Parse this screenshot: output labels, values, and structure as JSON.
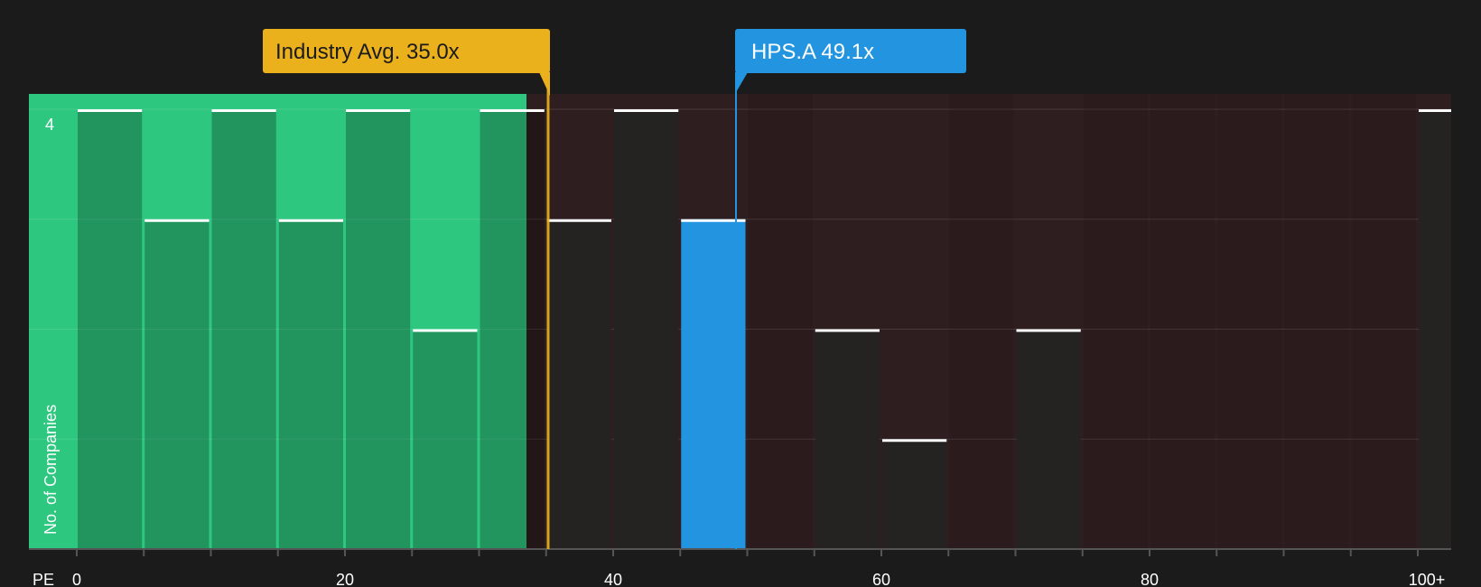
{
  "chart_data": {
    "type": "bar",
    "xlabel": "PE",
    "ylabel": "No. of Companies",
    "x_ticks": [
      "0",
      "20",
      "40",
      "60",
      "80",
      "100+"
    ],
    "y_tick_labels": [
      "4"
    ],
    "bins": [
      {
        "from": 0,
        "to": 5,
        "count": 4
      },
      {
        "from": 5,
        "to": 10,
        "count": 3
      },
      {
        "from": 10,
        "to": 15,
        "count": 4
      },
      {
        "from": 15,
        "to": 20,
        "count": 3
      },
      {
        "from": 20,
        "to": 25,
        "count": 4
      },
      {
        "from": 25,
        "to": 30,
        "count": 2
      },
      {
        "from": 30,
        "to": 35,
        "count": 4
      },
      {
        "from": 35,
        "to": 40,
        "count": 3
      },
      {
        "from": 40,
        "to": 45,
        "count": 4
      },
      {
        "from": 45,
        "to": 50,
        "count": 3
      },
      {
        "from": 50,
        "to": 55,
        "count": 0
      },
      {
        "from": 55,
        "to": 60,
        "count": 2
      },
      {
        "from": 60,
        "to": 65,
        "count": 1
      },
      {
        "from": 65,
        "to": 70,
        "count": 0
      },
      {
        "from": 70,
        "to": 75,
        "count": 2
      },
      {
        "from": 75,
        "to": 80,
        "count": 0
      },
      {
        "from": 80,
        "to": 85,
        "count": 0
      },
      {
        "from": 85,
        "to": 90,
        "count": 0
      },
      {
        "from": 90,
        "to": 95,
        "count": 0
      },
      {
        "from": 95,
        "to": 100,
        "count": 0
      },
      {
        "from": 100,
        "to": 105,
        "count": 4
      }
    ],
    "xlim": [
      0,
      102.5
    ],
    "ylim": [
      0,
      4
    ],
    "highlight_bin_index": 9,
    "industry_avg": {
      "label": "Industry Avg. 35.0x",
      "value": 35.0
    },
    "company": {
      "label": "HPS.A 49.1x",
      "value": 49.1
    },
    "grid": true,
    "colors": {
      "background": "#1b1b1b",
      "below_avg_region": "#2ec77f",
      "above_avg_region": "#2f1e1f",
      "bar_below": "#225a3e",
      "bar_above": "#252222",
      "bar_highlight": "#2394e0",
      "bar_top_line": "#ffffff",
      "industry_callout": "#eab11c",
      "company_callout": "#2394e0",
      "axis": "#555555"
    }
  }
}
